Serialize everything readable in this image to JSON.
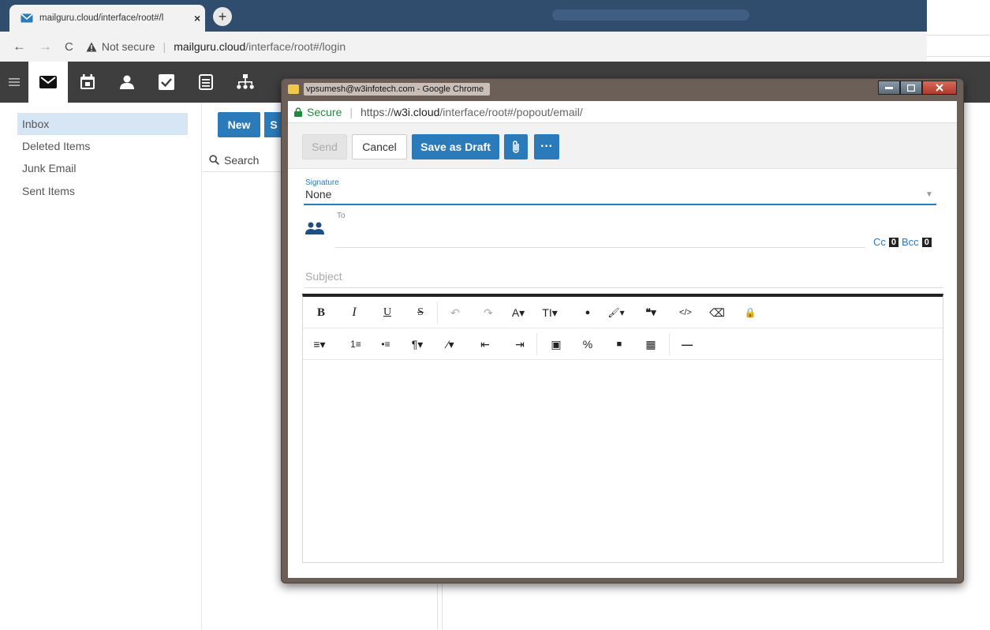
{
  "browser": {
    "tab_title": "mailguru.cloud/interface/root#/l",
    "tab_close": "×",
    "new_tab": "+",
    "back": "←",
    "forward": "→",
    "reload": "C",
    "security_text": "Not secure",
    "url_host": "mailguru.cloud",
    "url_path": "/interface/root#/login"
  },
  "folders": {
    "items": [
      {
        "label": "Inbox"
      },
      {
        "label": "Deleted Items"
      },
      {
        "label": "Junk Email"
      },
      {
        "label": "Sent Items"
      }
    ]
  },
  "list": {
    "new_label": "New",
    "second_label": "S",
    "search_placeholder": "Search"
  },
  "popup": {
    "window_title": "vpsumesh@w3infotech.com - Google Chrome",
    "secure_label": "Secure",
    "url_scheme": "https://",
    "url_host": "w3i.cloud",
    "url_path": "/interface/root#/popout/email/",
    "send_label": "Send",
    "cancel_label": "Cancel",
    "draft_label": "Save as Draft",
    "more_label": "···",
    "signature_label": "Signature",
    "signature_value": "None",
    "to_label": "To",
    "cc_label": "Cc",
    "cc_count": "0",
    "bcc_label": "Bcc",
    "bcc_count": "0",
    "subject_placeholder": "Subject"
  },
  "editor_toolbar": {
    "row1": [
      "B",
      "I",
      "U",
      "S",
      "↶",
      "↷",
      "A▾",
      "TI▾",
      "●",
      "🖌▾",
      "❝▾",
      "</>",
      "⌫",
      "🔒"
    ],
    "row2": [
      "≡▾",
      "1≡",
      "•≡",
      "¶▾",
      "⁄▾",
      "⇤",
      "⇥",
      "▣",
      "%",
      "■",
      "▦",
      "—"
    ]
  },
  "colors": {
    "accent": "#2b7bbb",
    "app_toolbar": "#3e3e3e",
    "browser_tabstrip": "#304d6e",
    "selected_folder": "#d6e6f5"
  }
}
